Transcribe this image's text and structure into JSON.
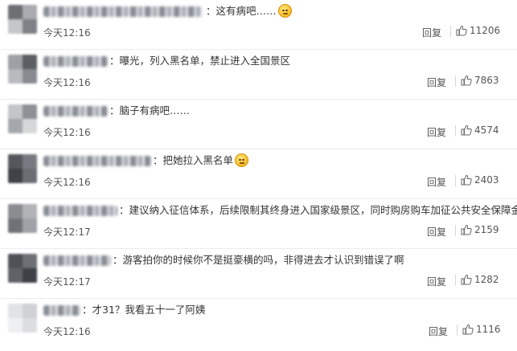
{
  "comments": [
    {
      "text": "：这有病吧……",
      "emoji": "smirk-emoji",
      "time": "今天12:16",
      "reply": "回复",
      "likes": "11206"
    },
    {
      "text": "：曝光，列入黑名单，禁止进入全国景区",
      "time": "今天12:16",
      "reply": "回复",
      "likes": "7863"
    },
    {
      "text": "：脑子有病吧……",
      "time": "今天12:16",
      "reply": "回复",
      "likes": "4574"
    },
    {
      "text": "：把她拉入黑名单",
      "emoji": "smile-emoji",
      "time": "今天12:16",
      "reply": "回复",
      "likes": "2403"
    },
    {
      "text": "：建议纳入征信体系，后续限制其终身进入国家级景区，同时购房购车加征公共安全保障金",
      "time": "今天12:17",
      "reply": "回复",
      "likes": "2159"
    },
    {
      "text": "：游客拍你的时候你不是挺豪横的吗，非得进去才认识到错误了啊",
      "time": "今天12:17",
      "reply": "回复",
      "likes": "1282"
    },
    {
      "text": "：才31？我看五十一了阿姨",
      "time": "今天12:16",
      "reply": "回复",
      "likes": "1116"
    }
  ]
}
